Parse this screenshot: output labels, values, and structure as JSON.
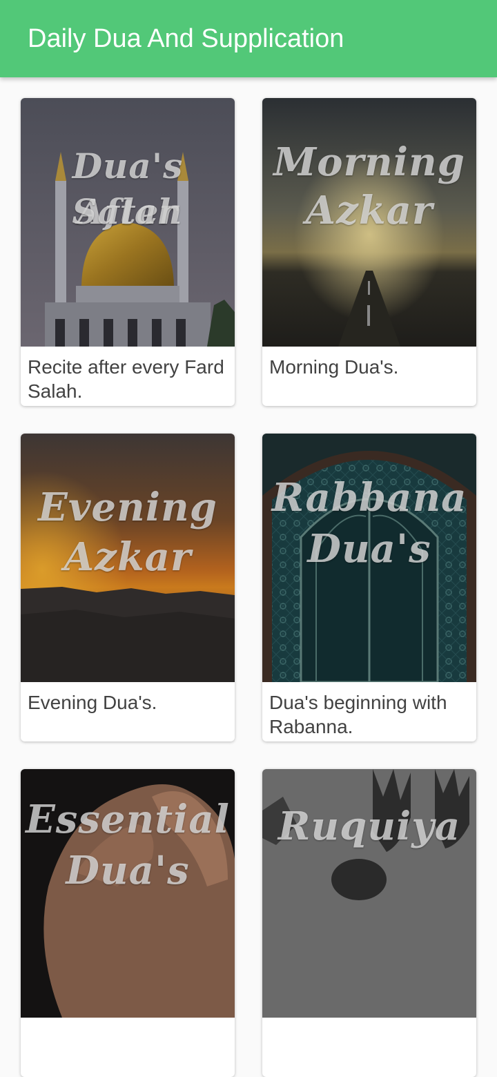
{
  "app_bar": {
    "title": "Daily Dua And Supplication"
  },
  "cards": [
    {
      "image_title_line1": "Dua's After",
      "image_title_line2": "Salah",
      "description": "Recite after every Fard Salah."
    },
    {
      "image_title_line1": "Morning",
      "image_title_line2": "Azkar",
      "description": "Morning Dua's."
    },
    {
      "image_title_line1": "Evening",
      "image_title_line2": "Azkar",
      "description": "Evening Dua's."
    },
    {
      "image_title_line1": "Rabbana",
      "image_title_line2": "Dua's",
      "description": "Dua's beginning with Rabanna."
    },
    {
      "image_title_line1": "Essential",
      "image_title_line2": "Dua's",
      "description": ""
    },
    {
      "image_title_line1": "Ruquiya",
      "image_title_line2": "",
      "description": ""
    }
  ],
  "colors": {
    "app_bar": "#52c878",
    "background": "#fafafa",
    "card_text": "#424242"
  }
}
